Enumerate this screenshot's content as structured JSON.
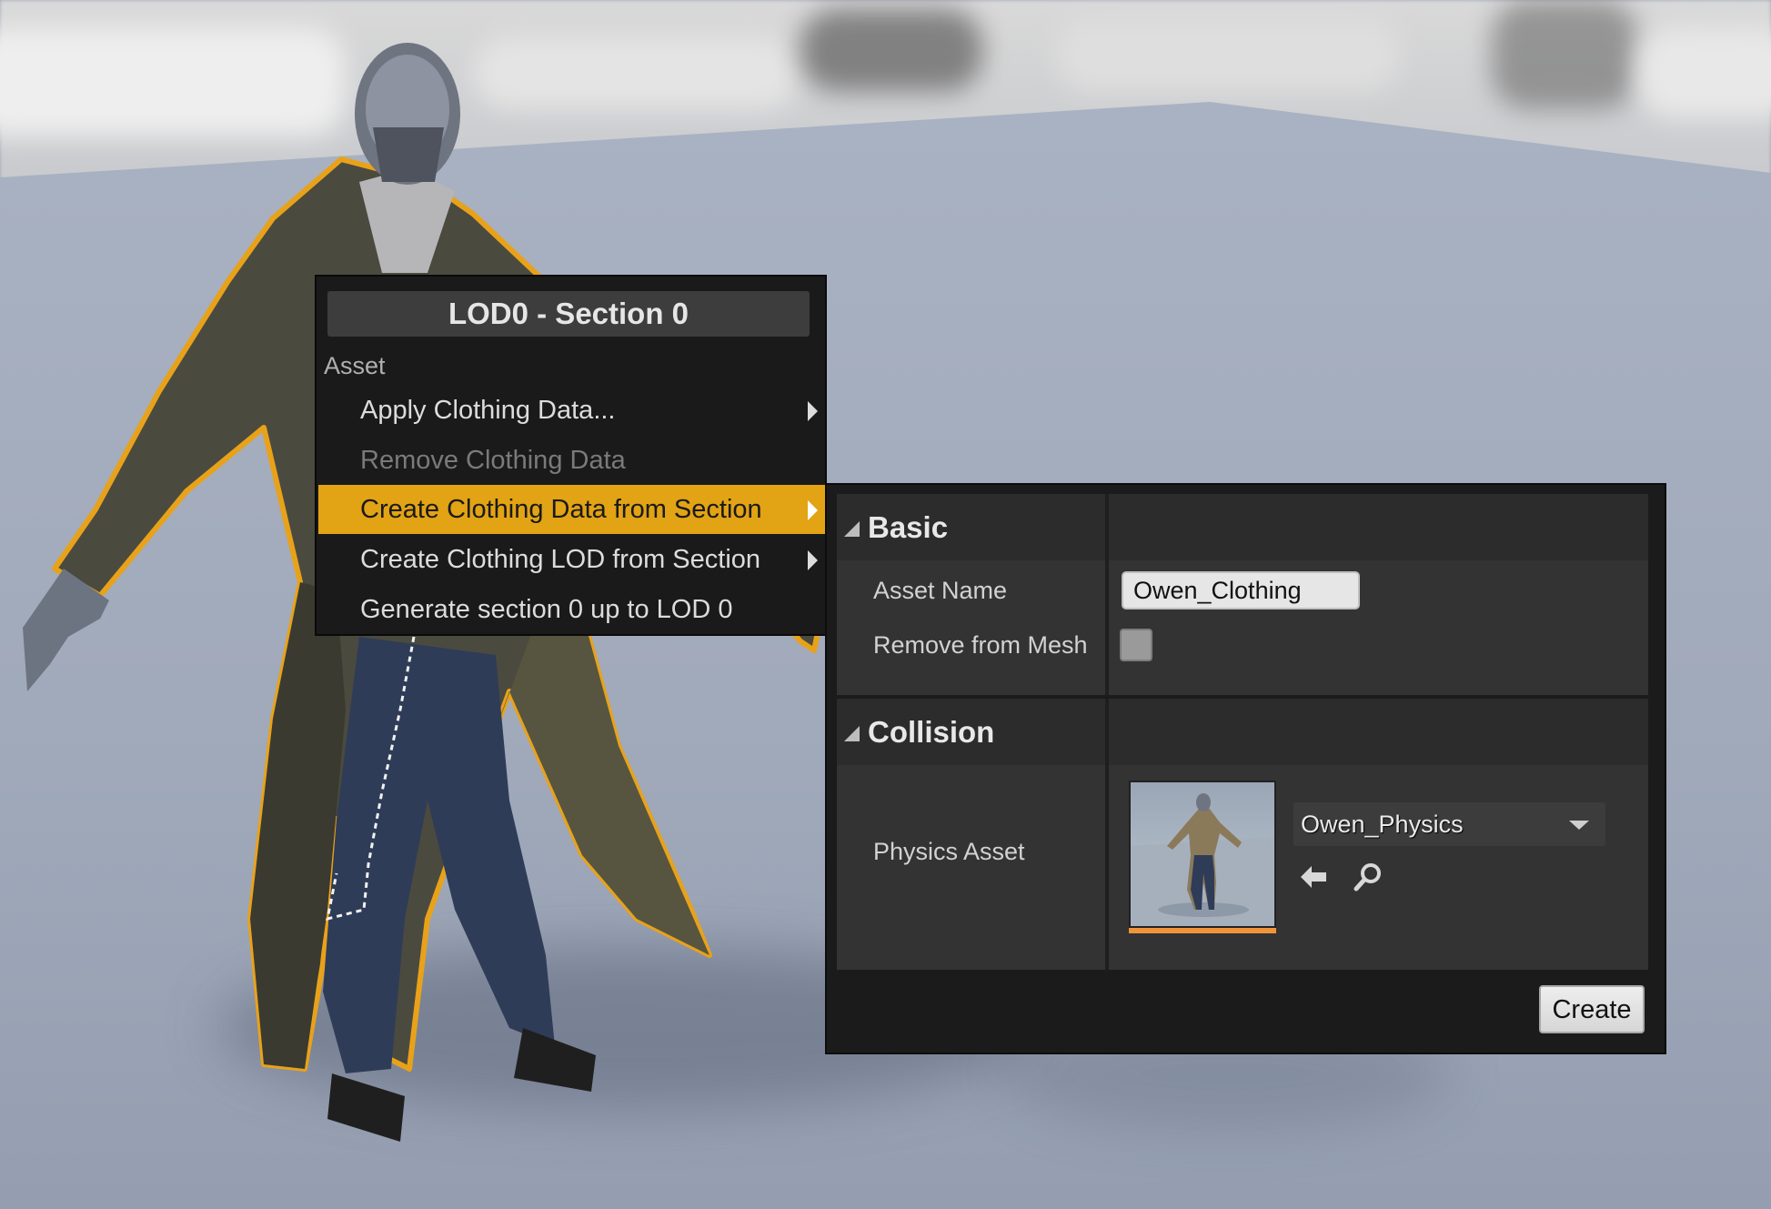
{
  "context_menu": {
    "title": "LOD0 - Section 0",
    "section_label": "Asset",
    "items": [
      {
        "label": "Apply Clothing Data...",
        "has_submenu": true,
        "enabled": true
      },
      {
        "label": "Remove Clothing Data",
        "has_submenu": false,
        "enabled": false
      },
      {
        "label": "Create Clothing Data from Section",
        "has_submenu": true,
        "enabled": true,
        "highlighted": true
      },
      {
        "label": "Create Clothing LOD from Section",
        "has_submenu": true,
        "enabled": true
      },
      {
        "label": "Generate section 0 up to LOD 0",
        "has_submenu": false,
        "enabled": true
      }
    ],
    "highlight_color": "#E2A315"
  },
  "dialog": {
    "basic": {
      "title": "Basic",
      "asset_name_label": "Asset Name",
      "asset_name_value": "Owen_Clothing",
      "remove_from_mesh_label": "Remove from Mesh",
      "remove_from_mesh_checked": false
    },
    "collision": {
      "title": "Collision",
      "physics_asset_label": "Physics Asset",
      "physics_asset_value": "Owen_Physics",
      "thumbnail_icon": "physics-asset-thumbnail",
      "use_selected_icon": "arrow-left-icon",
      "browse_icon": "search-icon"
    },
    "create_label": "Create"
  },
  "viewport": {
    "selection_outline_color": "#E8A21A",
    "floor_color": "#A7AFBF"
  }
}
